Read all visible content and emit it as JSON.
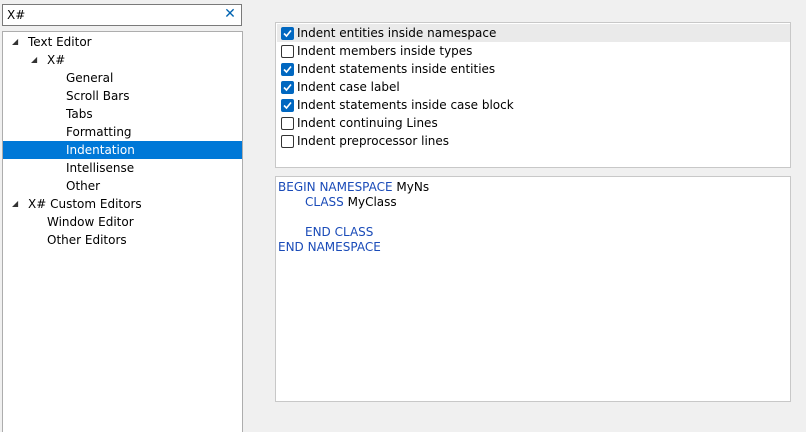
{
  "search": {
    "value": "X#",
    "clear_icon": "close-icon"
  },
  "tree": {
    "items": [
      {
        "label": "Text Editor",
        "expanded": true
      },
      {
        "label": "X#",
        "expanded": true
      },
      {
        "label": "General"
      },
      {
        "label": "Scroll Bars"
      },
      {
        "label": "Tabs"
      },
      {
        "label": "Formatting"
      },
      {
        "label": "Indentation",
        "selected": true
      },
      {
        "label": "Intellisense"
      },
      {
        "label": "Other"
      },
      {
        "label": "X# Custom Editors",
        "expanded": true
      },
      {
        "label": "Window Editor"
      },
      {
        "label": "Other Editors"
      }
    ]
  },
  "options": [
    {
      "label": "Indent entities inside namespace",
      "checked": true
    },
    {
      "label": "Indent members inside types",
      "checked": false
    },
    {
      "label": "Indent statements inside entities",
      "checked": true
    },
    {
      "label": "Indent case label",
      "checked": true
    },
    {
      "label": "Indent statements inside case block",
      "checked": true
    },
    {
      "label": "Indent continuing Lines",
      "checked": false
    },
    {
      "label": "Indent preprocessor lines",
      "checked": false
    }
  ],
  "preview": {
    "lines": [
      {
        "kw": "BEGIN NAMESPACE",
        "rest": " MyNs"
      },
      {
        "kw": "CLASS",
        "rest": " MyClass"
      },
      {
        "kw": "",
        "rest": ""
      },
      {
        "kw": "END CLASS",
        "rest": ""
      },
      {
        "kw": "END NAMESPACE",
        "rest": ""
      }
    ]
  },
  "colors": {
    "selection": "#0078d7",
    "checkbox_checked": "#0067c0",
    "keyword": "#1a4bb8"
  }
}
